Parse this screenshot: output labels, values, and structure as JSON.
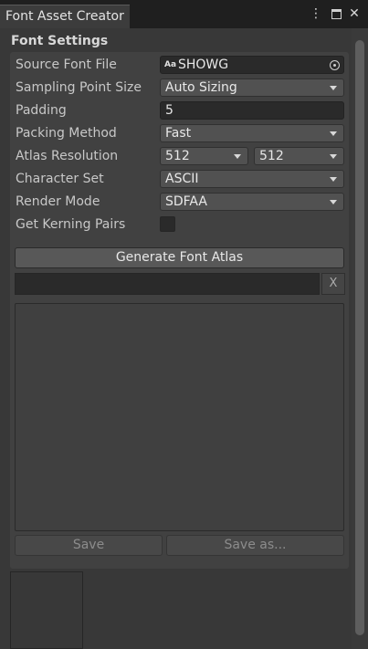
{
  "window": {
    "tab_title": "Font Asset Creator",
    "menu_icon": "kebab-menu-icon",
    "maximize_icon": "maximize-icon",
    "close_icon": "close-icon",
    "close_glyph": "✕",
    "menu_glyph": "⋮"
  },
  "section": {
    "title": "Font Settings"
  },
  "fields": {
    "source_font_file": {
      "label": "Source Font File",
      "value": "SHOWG",
      "badge": "Aa"
    },
    "sampling_point_size": {
      "label": "Sampling Point Size",
      "value": "Auto Sizing"
    },
    "padding": {
      "label": "Padding",
      "value": "5"
    },
    "packing_method": {
      "label": "Packing Method",
      "value": "Fast"
    },
    "atlas_resolution": {
      "label": "Atlas Resolution",
      "width": "512",
      "height": "512"
    },
    "character_set": {
      "label": "Character Set",
      "value": "ASCII"
    },
    "render_mode": {
      "label": "Render Mode",
      "value": "SDFAA"
    },
    "get_kerning_pairs": {
      "label": "Get Kerning Pairs",
      "checked": false
    }
  },
  "buttons": {
    "generate": "Generate Font Atlas",
    "clear": "X",
    "save": "Save",
    "save_as": "Save as..."
  },
  "colors": {
    "background": "#383838",
    "panel": "#414141",
    "field": "#2a2a2a",
    "dropdown": "#515151"
  }
}
